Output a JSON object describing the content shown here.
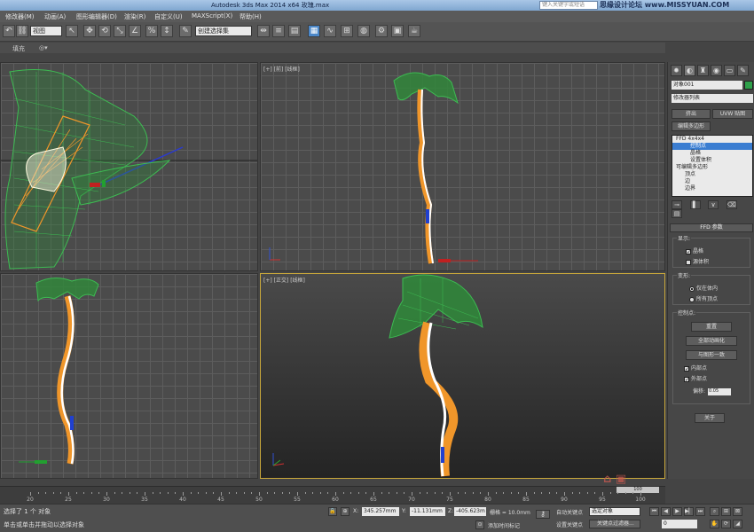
{
  "titlebar": {
    "title": "Autodesk 3ds Max  2014 x64      玫瑰.max",
    "search_placeholder": "键入关键字或短语",
    "watermark": "思缘设计论坛 www.MISSYUAN.COM"
  },
  "menubar": {
    "items": [
      "修改器(M)",
      "动画(A)",
      "图形编辑器(D)",
      "渲染(R)",
      "自定义(U)",
      "MAXScript(X)",
      "帮助(H)"
    ]
  },
  "toolbar": {
    "view_select": "视图",
    "selection_set": "创建选择集"
  },
  "ribbon": {
    "tab_fill": "填充",
    "tab_extra": "◎▾"
  },
  "viewports": {
    "top_right_label": "[+] [前] [线框]",
    "bottom_right_label": "[+] [正交] [线框]"
  },
  "command_panel": {
    "object_name": "对象001",
    "modifier_list": "修改器列表",
    "btn_extrude": "挤出",
    "btn_uvw": "UVW 贴图",
    "btn_edit_poly": "编辑多边形",
    "stack": [
      "FFD 4x4x4",
      "控制点",
      "晶格",
      "设置体积",
      "可编辑多边形",
      "顶点",
      "边",
      "边界"
    ],
    "stack_selected": 1,
    "rollout_title": "FFD 参数",
    "display_label": "显示:",
    "lattice": "晶格",
    "source_volume": "源体积",
    "deform_label": "变形:",
    "only_in_volume": "仅在体内",
    "all_vertices": "所有顶点",
    "control_points_label": "控制点:",
    "reset": "重置",
    "animate_all": "全部动画化",
    "conform_to_shape": "与图形一致",
    "inside_points": "内部点",
    "outside_points": "外部点",
    "offset_label": "偏移:",
    "offset_value": "0.05",
    "about": "关于"
  },
  "timeline": {
    "ticks": [
      "20",
      "25",
      "30",
      "35",
      "40",
      "45",
      "50",
      "55",
      "60",
      "65",
      "70",
      "75",
      "80",
      "85",
      "90",
      "95",
      "100"
    ],
    "slider": "100"
  },
  "statusbar": {
    "selected": "选择了 1 个 对象",
    "prompt": "单击或单击并拖动以选择对象",
    "x_label": "X:",
    "x_value": "345.257mm",
    "y_label": "Y:",
    "y_value": "-11.131mm",
    "z_label": "Z:",
    "z_value": "-405.623m",
    "grid": "栅格 = 10.0mm",
    "add_time_tag": "添加时间标记",
    "auto_key": "自动关键点",
    "selected_objects": "选定对象",
    "set_key": "设置关键点",
    "key_filters": "关键点过滤器...",
    "frame": "0"
  }
}
